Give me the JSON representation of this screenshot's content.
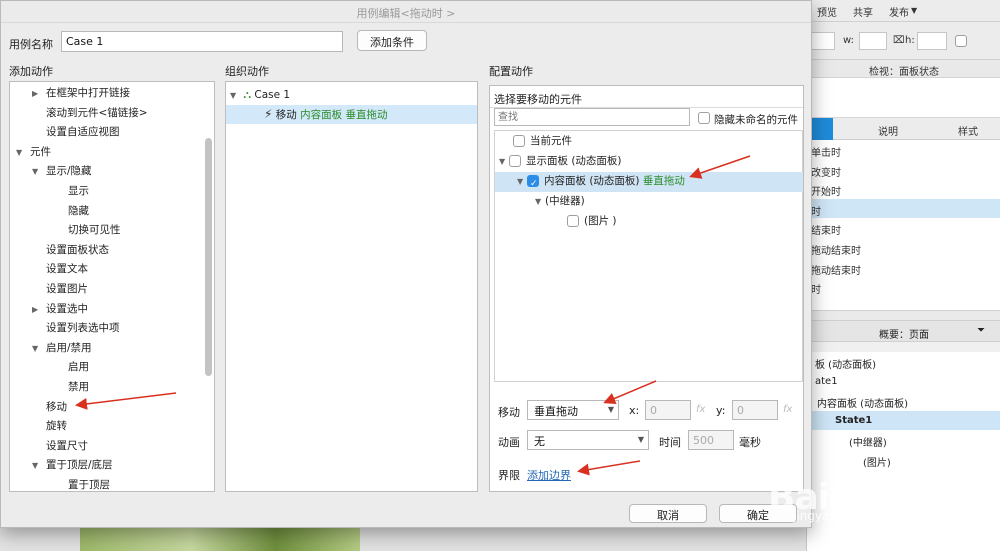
{
  "window_title": "用例编辑<拖动时 >",
  "case_name_label": "用例名称",
  "case_name_value": "Case 1",
  "add_condition_label": "添加条件",
  "add_action": {
    "title": "添加动作",
    "items": [
      {
        "label": "在框架中打开链接",
        "indent": 1,
        "arrow": "right"
      },
      {
        "label": "滚动到元件<锚链接>",
        "indent": 1,
        "arrow": ""
      },
      {
        "label": "设置自适应视图",
        "indent": 1,
        "arrow": ""
      },
      {
        "label": "元件",
        "indent": 0,
        "arrow": "down"
      },
      {
        "label": "显示/隐藏",
        "indent": 1,
        "arrow": "down"
      },
      {
        "label": "显示",
        "indent": 2,
        "arrow": ""
      },
      {
        "label": "隐藏",
        "indent": 2,
        "arrow": ""
      },
      {
        "label": "切换可见性",
        "indent": 2,
        "arrow": ""
      },
      {
        "label": "设置面板状态",
        "indent": 1,
        "arrow": ""
      },
      {
        "label": "设置文本",
        "indent": 1,
        "arrow": ""
      },
      {
        "label": "设置图片",
        "indent": 1,
        "arrow": ""
      },
      {
        "label": "设置选中",
        "indent": 1,
        "arrow": "right"
      },
      {
        "label": "设置列表选中项",
        "indent": 1,
        "arrow": ""
      },
      {
        "label": "启用/禁用",
        "indent": 1,
        "arrow": "down"
      },
      {
        "label": "启用",
        "indent": 2,
        "arrow": ""
      },
      {
        "label": "禁用",
        "indent": 2,
        "arrow": ""
      },
      {
        "label": "移动",
        "indent": 1,
        "arrow": ""
      },
      {
        "label": "旋转",
        "indent": 1,
        "arrow": ""
      },
      {
        "label": "设置尺寸",
        "indent": 1,
        "arrow": ""
      },
      {
        "label": "置于顶层/底层",
        "indent": 1,
        "arrow": "down"
      },
      {
        "label": "置于顶层",
        "indent": 2,
        "arrow": ""
      }
    ]
  },
  "organize_action": {
    "title": "组织动作",
    "case_label": "Case 1",
    "action_prefix": "移动",
    "action_target": "内容面板 垂直拖动"
  },
  "configure_action": {
    "title": "配置动作",
    "select_header": "选择要移动的元件",
    "search_placeholder": "查找",
    "hide_unnamed_label": "隐藏未命名的元件",
    "tree": [
      {
        "label": "当前元件",
        "suffix": "",
        "checked": false
      },
      {
        "label": "显示面板 (动态面板)",
        "suffix": "",
        "checked": false
      },
      {
        "label": "内容面板 (动态面板)",
        "suffix": "垂直拖动",
        "checked": true
      },
      {
        "label": "(中继器)",
        "suffix": "",
        "checked": null
      },
      {
        "label": "(图片 )",
        "suffix": "",
        "checked": false
      }
    ],
    "move_label": "移动",
    "move_value": "垂直拖动",
    "x_label": "x:",
    "x_value": "0",
    "y_label": "y:",
    "y_value": "0",
    "fx_label": "fx",
    "animation_label": "动画",
    "animation_value": "无",
    "time_label": "时间",
    "time_value": "500",
    "ms_label": "毫秒",
    "bounds_label": "界限",
    "add_bounds_link": "添加边界"
  },
  "footer": {
    "cancel_label": "取消",
    "ok_label": "确定"
  },
  "background_app": {
    "toolbar": [
      "预览",
      "共享",
      "发布"
    ],
    "w_label": "w:",
    "h_label": "h:",
    "inspector_title": "检视：面板状态",
    "tabs": [
      "说明",
      "样式"
    ],
    "events": [
      "单击时",
      "改变时",
      "开始时",
      "时",
      "结束时",
      "拖动结束时",
      "拖动结束时",
      "时"
    ],
    "summary_title": "概要：页面",
    "summary_tree": [
      "板 (动态面板)",
      "ate1",
      "内容面板 (动态面板)",
      "State1",
      "(中继器)",
      "(图片)"
    ]
  },
  "watermark": "Baidu经验",
  "watermark_sub": "jingyan.baidu.com"
}
